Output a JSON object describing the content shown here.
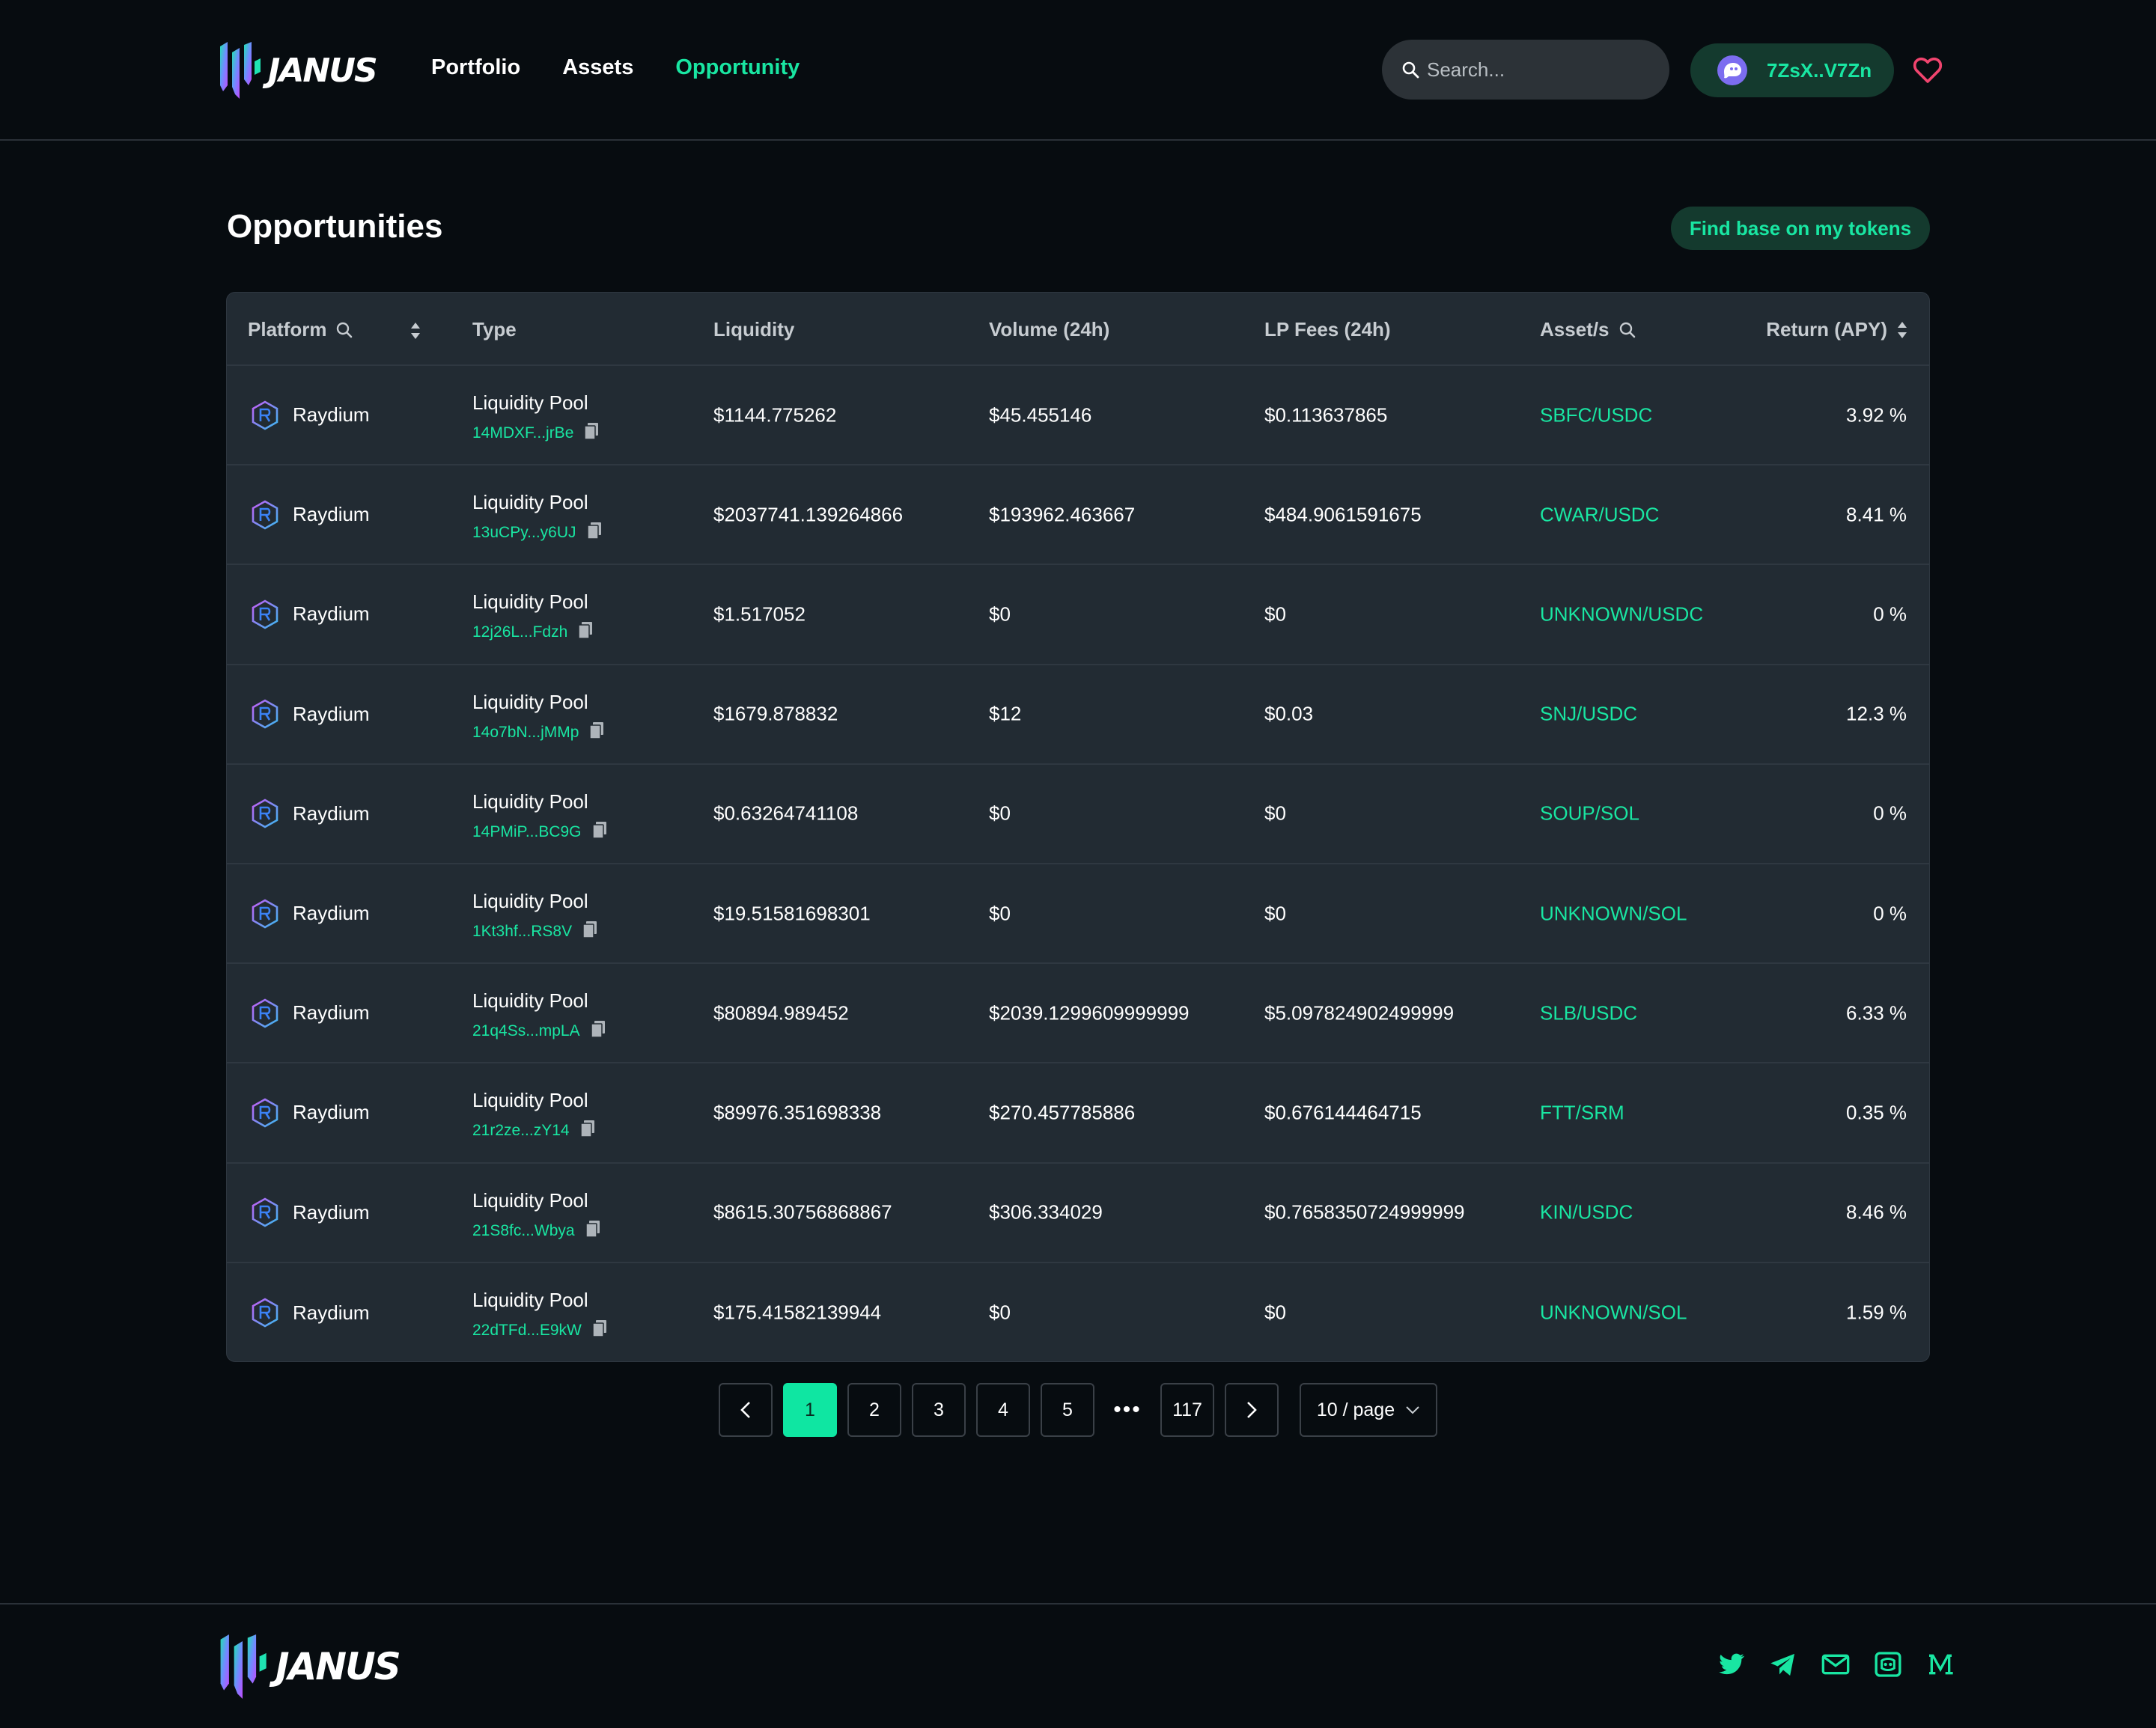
{
  "brand": {
    "name": "JANUS"
  },
  "nav": {
    "items": [
      "Portfolio",
      "Assets",
      "Opportunity"
    ],
    "active_index": 2
  },
  "search": {
    "placeholder": "Search..."
  },
  "wallet": {
    "address": "7ZsX..V7Zn"
  },
  "page": {
    "title": "Opportunities",
    "find_button": "Find base on my tokens"
  },
  "table": {
    "headers": {
      "platform": "Platform",
      "type": "Type",
      "liquidity": "Liquidity",
      "volume": "Volume (24h)",
      "fees": "LP Fees (24h)",
      "assets": "Asset/s",
      "return": "Return (APY)"
    },
    "rows": [
      {
        "platform": "Raydium",
        "type": "Liquidity Pool",
        "address": "14MDXF...jrBe",
        "liquidity": "$1144.775262",
        "volume": "$45.455146",
        "fees": "$0.113637865",
        "asset": "SBFC/USDC",
        "apy": "3.92 %"
      },
      {
        "platform": "Raydium",
        "type": "Liquidity Pool",
        "address": "13uCPy...y6UJ",
        "liquidity": "$2037741.139264866",
        "volume": "$193962.463667",
        "fees": "$484.9061591675",
        "asset": "CWAR/USDC",
        "apy": "8.41 %"
      },
      {
        "platform": "Raydium",
        "type": "Liquidity Pool",
        "address": "12j26L...Fdzh",
        "liquidity": "$1.517052",
        "volume": "$0",
        "fees": "$0",
        "asset": "UNKNOWN/USDC",
        "apy": "0 %"
      },
      {
        "platform": "Raydium",
        "type": "Liquidity Pool",
        "address": "14o7bN...jMMp",
        "liquidity": "$1679.878832",
        "volume": "$12",
        "fees": "$0.03",
        "asset": "SNJ/USDC",
        "apy": "12.3 %"
      },
      {
        "platform": "Raydium",
        "type": "Liquidity Pool",
        "address": "14PMiP...BC9G",
        "liquidity": "$0.63264741108",
        "volume": "$0",
        "fees": "$0",
        "asset": "SOUP/SOL",
        "apy": "0 %"
      },
      {
        "platform": "Raydium",
        "type": "Liquidity Pool",
        "address": "1Kt3hf...RS8V",
        "liquidity": "$19.51581698301",
        "volume": "$0",
        "fees": "$0",
        "asset": "UNKNOWN/SOL",
        "apy": "0 %"
      },
      {
        "platform": "Raydium",
        "type": "Liquidity Pool",
        "address": "21q4Ss...mpLA",
        "liquidity": "$80894.989452",
        "volume": "$2039.1299609999999",
        "fees": "$5.097824902499999",
        "asset": "SLB/USDC",
        "apy": "6.33 %"
      },
      {
        "platform": "Raydium",
        "type": "Liquidity Pool",
        "address": "21r2ze...zY14",
        "liquidity": "$89976.351698338",
        "volume": "$270.457785886",
        "fees": "$0.676144464715",
        "asset": "FTT/SRM",
        "apy": "0.35 %"
      },
      {
        "platform": "Raydium",
        "type": "Liquidity Pool",
        "address": "21S8fc...Wbya",
        "liquidity": "$8615.30756868867",
        "volume": "$306.334029",
        "fees": "$0.7658350724999999",
        "asset": "KIN/USDC",
        "apy": "8.46 %"
      },
      {
        "platform": "Raydium",
        "type": "Liquidity Pool",
        "address": "22dTFd...E9kW",
        "liquidity": "$175.41582139944",
        "volume": "$0",
        "fees": "$0",
        "asset": "UNKNOWN/SOL",
        "apy": "1.59 %"
      }
    ]
  },
  "pagination": {
    "pages": [
      "1",
      "2",
      "3",
      "4",
      "5"
    ],
    "current": "1",
    "ellipsis": "•••",
    "last": "117",
    "page_size": "10 / page"
  },
  "icons": {
    "search": "search-icon",
    "sort": "sort-icon",
    "copy": "copy-icon",
    "platform": "raydium-icon",
    "favorite": "heart-icon",
    "socials": [
      "twitter-icon",
      "telegram-icon",
      "mail-icon",
      "discord-icon",
      "medium-icon"
    ]
  },
  "colors": {
    "accent": "#19e6a2",
    "background": "#070c10",
    "panel": "#222b33",
    "favorite": "#f0446e"
  }
}
